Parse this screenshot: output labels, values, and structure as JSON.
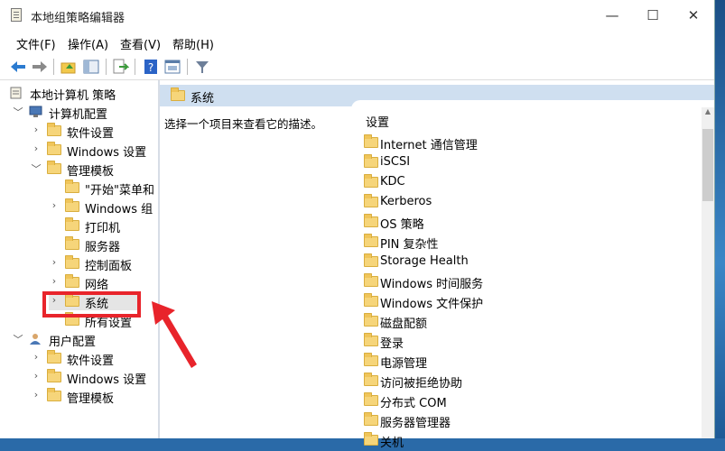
{
  "window": {
    "title": "本地组策略编辑器"
  },
  "controls": {
    "minimize": "—",
    "maximize": "☐",
    "close": "✕"
  },
  "menu": [
    "文件(F)",
    "操作(A)",
    "查看(V)",
    "帮助(H)"
  ],
  "tree": {
    "root": "本地计算机 策略",
    "computer_config": "计算机配置",
    "software_settings": "软件设置",
    "windows_settings": "Windows 设置",
    "admin_templates": "管理模板",
    "start_menu": "\"开始\"菜单和",
    "windows_components": "Windows 组",
    "printers": "打印机",
    "server": "服务器",
    "control_panel": "控制面板",
    "network": "网络",
    "system": "系统",
    "all_settings": "所有设置",
    "user_config": "用户配置",
    "user_software_settings": "软件设置",
    "user_windows_settings": "Windows 设置",
    "user_admin_templates": "管理模板"
  },
  "right": {
    "header": "系统",
    "description": "选择一个项目来查看它的描述。",
    "column": "设置",
    "items": [
      "Internet 通信管理",
      "iSCSI",
      "KDC",
      "Kerberos",
      "OS 策略",
      "PIN 复杂性",
      "Storage Health",
      "Windows 时间服务",
      "Windows 文件保护",
      "磁盘配额",
      "登录",
      "电源管理",
      "访问被拒绝协助",
      "分布式 COM",
      "服务器管理器",
      "关机"
    ]
  },
  "colors": {
    "highlight": "#e8242b",
    "header_bg": "#cfdff0",
    "folder": "#f6d57a"
  }
}
